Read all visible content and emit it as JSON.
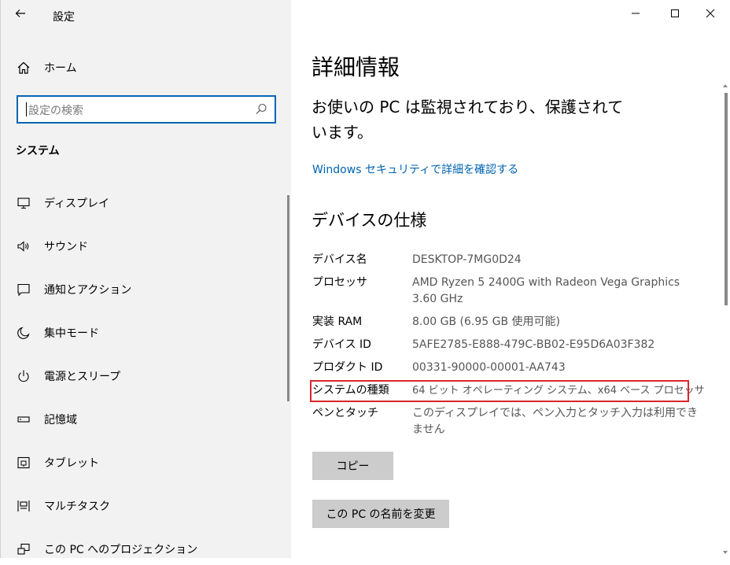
{
  "window": {
    "title": "設定",
    "controls": [
      "minimize",
      "maximize",
      "close"
    ]
  },
  "sidebar": {
    "home_label": "ホーム",
    "search_placeholder": "設定の検索",
    "section_title": "システム",
    "items": [
      {
        "label": "ディスプレイ",
        "icon": "monitor-icon"
      },
      {
        "label": "サウンド",
        "icon": "speaker-icon"
      },
      {
        "label": "通知とアクション",
        "icon": "notification-icon"
      },
      {
        "label": "集中モード",
        "icon": "moon-icon"
      },
      {
        "label": "電源とスリープ",
        "icon": "power-icon"
      },
      {
        "label": "記憶域",
        "icon": "storage-icon"
      },
      {
        "label": "タブレット",
        "icon": "tablet-icon"
      },
      {
        "label": "マルチタスク",
        "icon": "multitask-icon"
      },
      {
        "label": "この PC へのプロジェクション",
        "icon": "projection-icon"
      }
    ]
  },
  "main": {
    "title": "詳細情報",
    "protection_message": "お使いの PC は監視されており、保護されています。",
    "security_link": "Windows セキュリティで詳細を確認する",
    "spec_section_title": "デバイスの仕様",
    "specs": [
      {
        "key": "デバイス名",
        "value": "DESKTOP-7MG0D24"
      },
      {
        "key": "プロセッサ",
        "value": "AMD Ryzen 5 2400G with Radeon Vega Graphics 3.60 GHz"
      },
      {
        "key": "実装 RAM",
        "value": "8.00 GB (6.95 GB 使用可能)"
      },
      {
        "key": "デバイス ID",
        "value": "5AFE2785-E888-479C-BB02-E95D6A03F382"
      },
      {
        "key": "プロダクト ID",
        "value": "00331-90000-00001-AA743"
      },
      {
        "key": "システムの種類",
        "value": "64 ビット オペレーティング システム、x64 ベース プロセッサ"
      },
      {
        "key": "ペンとタッチ",
        "value": "このディスプレイでは、ペン入力とタッチ入力は利用できません"
      }
    ],
    "copy_button": "コピー",
    "rename_button": "この PC の名前を変更"
  },
  "colors": {
    "accent": "#0063b1",
    "highlight": "#d9262b",
    "sidebar_bg": "#f2f2f2",
    "button_bg": "#cccccc"
  }
}
